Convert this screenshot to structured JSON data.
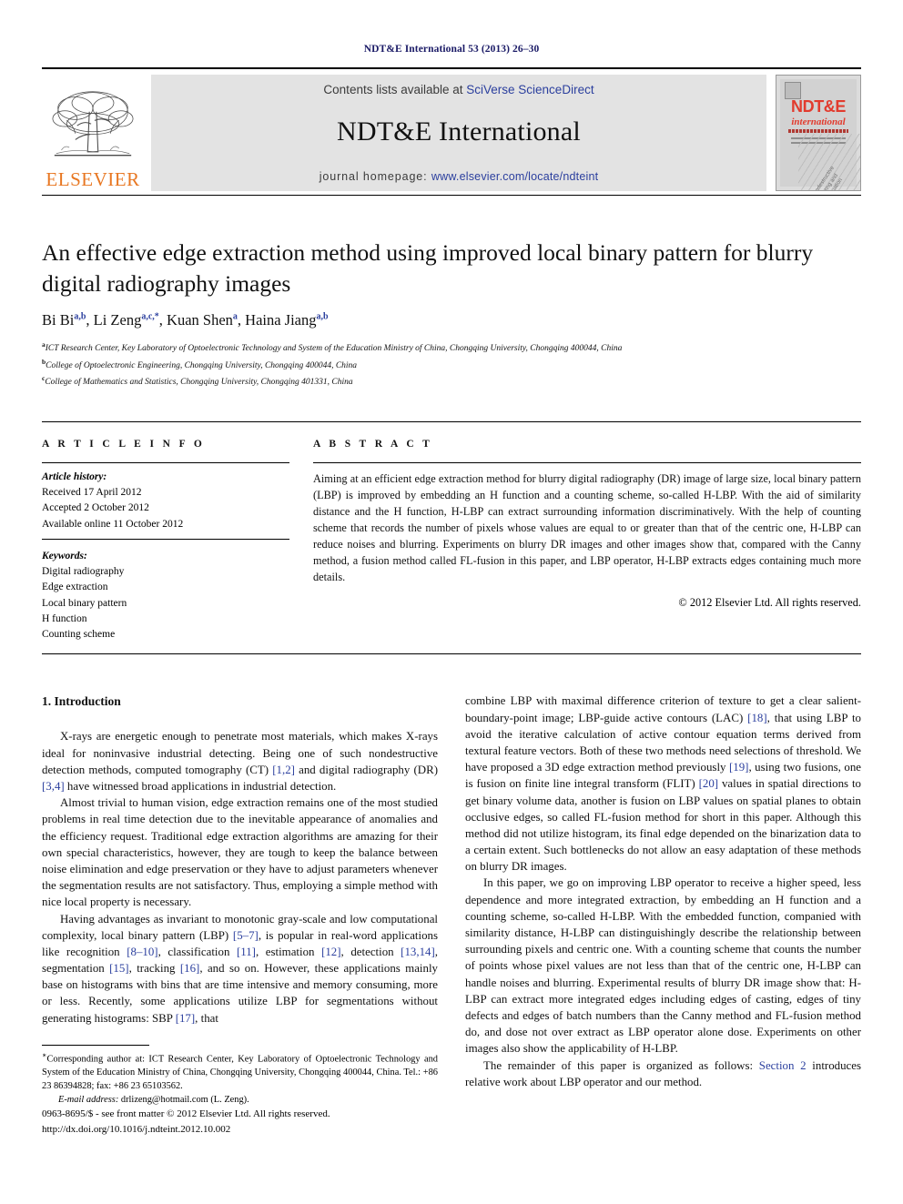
{
  "running_head": "NDT&E International 53 (2013) 26–30",
  "masthead": {
    "elsevier_wordmark": "ELSEVIER",
    "contents_prefix": "Contents lists available at ",
    "contents_link": "SciVerse ScienceDirect",
    "journal_name": "NDT&E International",
    "homepage_prefix": "journal homepage: ",
    "homepage_url": "www.elsevier.com/locate/ndteint",
    "cover": {
      "title": "NDT&E",
      "subtitle": "international",
      "blurb": "Nondestructive Testing and Evaluation"
    }
  },
  "article": {
    "title": "An effective edge extraction method using improved local binary pattern for blurry digital radiography images",
    "authors": [
      {
        "name": "Bi Bi",
        "marks": "a,b"
      },
      {
        "name": "Li Zeng",
        "marks": "a,c,*"
      },
      {
        "name": "Kuan Shen",
        "marks": "a"
      },
      {
        "name": "Haina Jiang",
        "marks": "a,b"
      }
    ],
    "authors_line": "Bi Bi a,b, Li Zeng a,c,*, Kuan Shen a, Haina Jiang a,b",
    "affiliations": [
      {
        "letter": "a",
        "text": "ICT Research Center, Key Laboratory of Optoelectronic Technology and System of the Education Ministry of China, Chongqing University, Chongqing 400044, China"
      },
      {
        "letter": "b",
        "text": "College of Optoelectronic Engineering, Chongqing University, Chongqing 400044, China"
      },
      {
        "letter": "c",
        "text": "College of Mathematics and Statistics, Chongqing University, Chongqing 401331, China"
      }
    ]
  },
  "article_info": {
    "heading": "A R T I C L E   I N F O",
    "history_label": "Article history:",
    "history": [
      "Received 17 April 2012",
      "Accepted 2 October 2012",
      "Available online 11 October 2012"
    ],
    "keywords_label": "Keywords:",
    "keywords": [
      "Digital radiography",
      "Edge extraction",
      "Local binary pattern",
      "H function",
      "Counting scheme"
    ]
  },
  "abstract": {
    "heading": "A B S T R A C T",
    "text": "Aiming at an efficient edge extraction method for blurry digital radiography (DR) image of large size, local binary pattern (LBP) is improved by embedding an H function and a counting scheme, so-called H-LBP. With the aid of similarity distance and the H function, H-LBP can extract surrounding information discriminatively. With the help of counting scheme that records the number of pixels whose values are equal to or greater than that of the centric one, H-LBP can reduce noises and blurring. Experiments on blurry DR images and other images show that, compared with the Canny method, a fusion method called FL-fusion in this paper, and LBP operator, H-LBP extracts edges containing much more details.",
    "copyright": "© 2012 Elsevier Ltd. All rights reserved."
  },
  "introduction": {
    "heading": "1.  Introduction",
    "left_paragraphs": [
      "X-rays are energetic enough to penetrate most materials, which makes X-rays ideal for noninvasive industrial detecting. Being one of such nondestructive detection methods, computed tomography (CT) [1,2] and digital radiography (DR) [3,4] have witnessed broad applications in industrial detection.",
      "Almost trivial to human vision, edge extraction remains one of the most studied problems in real time detection due to the inevitable appearance of anomalies and the efficiency request. Traditional edge extraction algorithms are amazing for their own special characteristics, however, they are tough to keep the balance between noise elimination and edge preservation or they have to adjust parameters whenever the segmentation results are not satisfactory. Thus, employing a simple method with nice local property is necessary.",
      "Having advantages as invariant to monotonic gray-scale and low computational complexity, local binary pattern (LBP) [5–7], is popular in real-word applications like recognition [8–10], classification [11], estimation [12], detection [13,14], segmentation [15], tracking [16], and so on. However, these applications mainly base on histograms with bins that are time intensive and memory consuming, more or less. Recently, some applications utilize LBP for segmentations without generating histograms: SBP [17], that"
    ],
    "right_paragraphs": [
      "combine LBP with maximal difference criterion of texture to get a clear salient-boundary-point image; LBP-guide active contours (LAC) [18], that using LBP to avoid the iterative calculation of active contour equation terms derived from textural feature vectors. Both of these two methods need selections of threshold. We have proposed a 3D edge extraction method previously [19], using two fusions, one is fusion on finite line integral transform (FLIT) [20] values in spatial directions to get binary volume data, another is fusion on LBP values on spatial planes to obtain occlusive edges, so called FL-fusion method for short in this paper. Although this method did not utilize histogram, its final edge depended on the binarization data to a certain extent. Such bottlenecks do not allow an easy adaptation of these methods on blurry DR images.",
      "In this paper, we go on improving LBP operator to receive a higher speed, less dependence and more integrated extraction, by embedding an H function and a counting scheme, so-called H-LBP. With the embedded function, companied with similarity distance, H-LBP can distinguishingly describe the relationship between surrounding pixels and centric one. With a counting scheme that counts the number of points whose pixel values are not less than that of the centric one, H-LBP can handle noises and blurring. Experimental results of blurry DR image show that: H-LBP can extract more integrated edges including edges of casting, edges of tiny defects and edges of batch numbers than the Canny method and FL-fusion method do, and dose not over extract as LBP operator alone dose. Experiments on other images also show the applicability of H-LBP.",
      "The remainder of this paper is organized as follows: Section 2 introduces relative work about LBP operator and our method."
    ]
  },
  "footnote": {
    "corresponding": "Corresponding author at: ICT Research Center, Key Laboratory of Optoelectronic Technology and System of the Education Ministry of China, Chongqing University, Chongqing 400044, China. Tel.: +86 23 86394828; fax: +86 23 65103562.",
    "email_label": "E-mail address:",
    "email": "drlizeng@hotmail.com (L. Zeng)."
  },
  "footer": {
    "issn_line": "0963-8695/$ - see front matter © 2012 Elsevier Ltd. All rights reserved.",
    "doi_line": "http://dx.doi.org/10.1016/j.ndteint.2012.10.002"
  },
  "colors": {
    "link_blue": "#2b3f9e",
    "elsevier_orange": "#E87722",
    "cover_red": "#e23b2e",
    "band_gray": "#e3e3e3"
  }
}
